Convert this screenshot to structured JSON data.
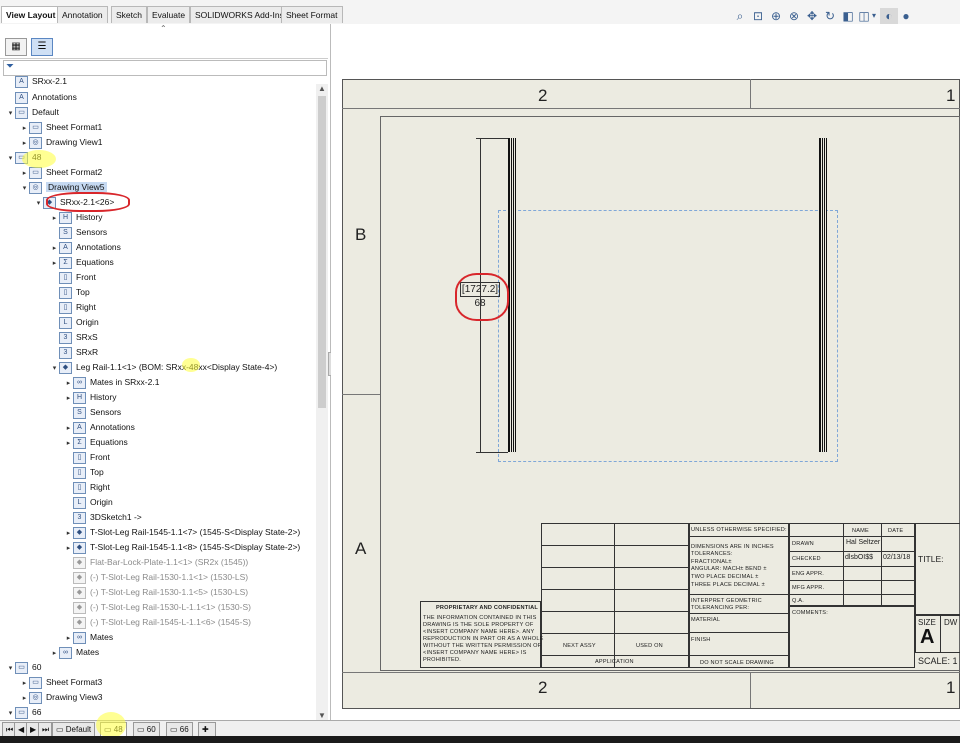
{
  "tabs": [
    "View Layout",
    "Annotation",
    "Sketch",
    "Evaluate",
    "SOLIDWORKS Add-Ins",
    "Sheet Format"
  ],
  "toolbar_icons": [
    "zoom-to-fit-icon",
    "zoom-to-area-icon",
    "zoom-in-out-icon",
    "zoom-selection-icon",
    "pan-icon",
    "rotate-icon",
    "3d-view-icon",
    "display-style-icon",
    "dropdown-icon",
    "hide-show-icon",
    "scene-icon"
  ],
  "tree": {
    "root": "SRxx-2.1",
    "annotations": "Annotations",
    "default_sheet": "Default",
    "sheet_format1": "Sheet Format1",
    "drawing_view1": "Drawing View1",
    "sheet_48": "48",
    "sheet_format2": "Sheet Format2",
    "drawing_view5": "Drawing View5",
    "part_srxx": "SRxx-2.1<26>",
    "history": "History",
    "sensors": "Sensors",
    "annotations2": "Annotations",
    "equations": "Equations",
    "front": "Front",
    "top": "Top",
    "right": "Right",
    "origin": "Origin",
    "srxs": "SRxS",
    "srxr": "SRxR",
    "leg_rail": "Leg Rail-1.1<1> (BOM: SRxx-48xx<Display State-4>)",
    "mates_in": "Mates in SRxx-2.1",
    "history2": "History",
    "sensors2": "Sensors",
    "annotations3": "Annotations",
    "equations2": "Equations",
    "front2": "Front",
    "top2": "Top",
    "right2": "Right",
    "origin2": "Origin",
    "sketch": "3DSketch1 ->",
    "tslot1": "T-Slot-Leg Rail-1545-1.1<7> (1545-S<Display State-2>)",
    "tslot2": "T-Slot-Leg Rail-1545-1.1<8> (1545-S<Display State-2>)",
    "flatbar": "Flat-Bar-Lock-Plate-1.1<1> (SR2x (1545))",
    "sup1": "(-) T-Slot-Leg Rail-1530-1.1<1> (1530-LS)",
    "sup2": "(-) T-Slot-Leg Rail-1530-1.1<5> (1530-LS)",
    "sup3": "(-) T-Slot-Leg Rail-1530-L-1.1<1> (1530-S)",
    "sup4": "(-) T-Slot-Leg Rail-1545-L-1.1<6> (1545-S)",
    "mates1": "Mates",
    "mates2": "Mates",
    "sheet_60": "60",
    "sheet_format3": "Sheet Format3",
    "drawing_view3": "Drawing View3",
    "sheet_66": "66"
  },
  "sheet_tabs": [
    "Default",
    "48",
    "60",
    "66"
  ],
  "drawing": {
    "zone_top_2": "2",
    "zone_top_1": "1",
    "zone_bottom_2": "2",
    "zone_bottom_1": "1",
    "zone_b": "B",
    "zone_a": "A",
    "dim_primary": "[1727.2]",
    "dim_secondary": "68"
  },
  "title_block": {
    "unless": "UNLESS OTHERWISE SPECIFIED:",
    "name": "NAME",
    "date": "DATE",
    "dims_in": "DIMENSIONS ARE IN INCHES",
    "tolerances": "TOLERANCES:",
    "fractional": "FRACTIONAL±",
    "angular": "ANGULAR: MACH±   BEND ±",
    "two_place": "TWO PLACE DECIMAL   ±",
    "three_place": "THREE PLACE DECIMAL  ±",
    "drawn": "DRAWN",
    "drawn_name": "Hal Seltzer",
    "checked": "CHECKED",
    "checked_name": "dlsbOI$$",
    "checked_date": "02/13/18",
    "title": "TITLE:",
    "eng_appr": "ENG APPR.",
    "mfg_appr": "MFG APPR.",
    "qa": "Q.A.",
    "comments": "COMMENTS:",
    "interpret": "INTERPRET GEOMETRIC",
    "tolerancing": "TOLERANCING PER:",
    "material": "MATERIAL",
    "finish": "FINISH",
    "prop_title": "PROPRIETARY AND CONFIDENTIAL",
    "prop_text_1": "THE INFORMATION CONTAINED IN THIS",
    "prop_text_2": "DRAWING IS THE SOLE PROPERTY OF",
    "prop_text_3": "<INSERT COMPANY NAME HERE>. ANY",
    "prop_text_4": "REPRODUCTION IN PART OR AS A WHOLE",
    "prop_text_5": "WITHOUT THE WRITTEN PERMISSION OF",
    "prop_text_6": "<INSERT COMPANY NAME HERE> IS",
    "prop_text_7": "PROHIBITED.",
    "next_assy": "NEXT ASSY",
    "used_on": "USED ON",
    "application": "APPLICATION",
    "do_not_scale": "DO NOT SCALE DRAWING",
    "size": "SIZE",
    "size_value": "A",
    "dwg": "DW",
    "scale": "SCALE: 1"
  },
  "colors": {
    "highlight": "#ffff3a",
    "annotation_ring": "#d8262b",
    "sheet": "#ecebe1",
    "selection": "#c5d9f1"
  }
}
